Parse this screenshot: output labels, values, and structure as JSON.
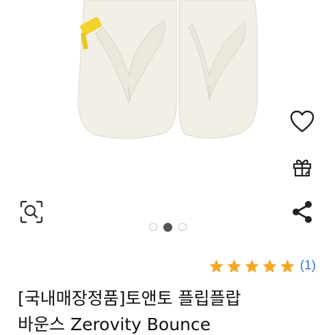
{
  "carousel": {
    "total_slides": 3,
    "active_index": 1
  },
  "icons": {
    "wishlist": "heart-outline-icon",
    "gift": "gift-icon",
    "share": "share-icon",
    "zoom": "zoom-search-icon"
  },
  "rating": {
    "stars": 5,
    "star_color": "#f5a623",
    "review_count_label": "(1)"
  },
  "product": {
    "title_line1": "[국내매장정품]토앤토 플립플랍",
    "title_line2": "바운스 Zerovity Bounce"
  },
  "colors": {
    "accent_link": "#3d73d6",
    "sandal": "#f2efe6",
    "strap_accent": "#f2d22b"
  }
}
